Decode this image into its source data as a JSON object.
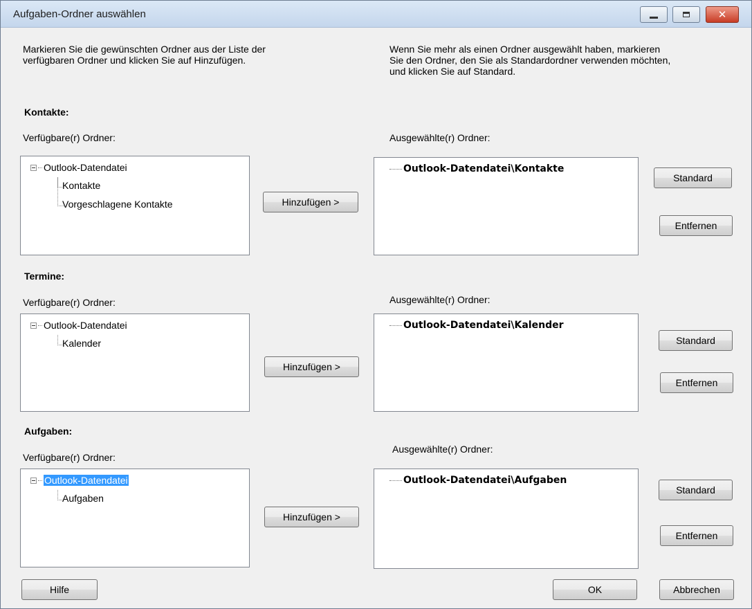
{
  "window": {
    "title": "Aufgaben-Ordner auswählen",
    "close_glyph": "✕"
  },
  "instructions": {
    "left_line1": "Markieren Sie die gewünschten Ordner aus der Liste der",
    "left_line2": "verfügbaren Ordner und klicken Sie auf Hinzufügen.",
    "right_line1": "Wenn Sie mehr als einen Ordner ausgewählt haben, markieren",
    "right_line2": "Sie den Ordner, den Sie als Standardordner verwenden möchten,",
    "right_line3": "und klicken Sie auf Standard."
  },
  "sections": [
    {
      "heading": "Kontakte:",
      "available_label": "Verfügbare(r) Ordner:",
      "selected_label": "Ausgewählte(r) Ordner:",
      "tree_root": "Outlook-Datendatei",
      "tree_children": [
        "Kontakte",
        "Vorgeschlagene Kontakte"
      ],
      "selected_item": "Outlook-Datendatei\\Kontakte",
      "add_button": "Hinzufügen >",
      "standard_button": "Standard",
      "remove_button": "Entfernen"
    },
    {
      "heading": "Termine:",
      "available_label": "Verfügbare(r) Ordner:",
      "selected_label": "Ausgewählte(r) Ordner:",
      "tree_root": "Outlook-Datendatei",
      "tree_children": [
        "Kalender"
      ],
      "selected_item": "Outlook-Datendatei\\Kalender",
      "add_button": "Hinzufügen >",
      "standard_button": "Standard",
      "remove_button": "Entfernen"
    },
    {
      "heading": "Aufgaben:",
      "available_label": "Verfügbare(r) Ordner:",
      "selected_label": "Ausgewählte(r) Ordner:",
      "tree_root": "Outlook-Datendatei",
      "tree_children": [
        "Aufgaben"
      ],
      "selected_item": "Outlook-Datendatei\\Aufgaben",
      "add_button": "Hinzufügen >",
      "standard_button": "Standard",
      "remove_button": "Entfernen"
    }
  ],
  "footer": {
    "help_button": "Hilfe",
    "ok_button": "OK",
    "cancel_button": "Abbrechen"
  },
  "colors": {
    "selection_highlight": "#3399ff",
    "close_button": "#c83c25"
  }
}
